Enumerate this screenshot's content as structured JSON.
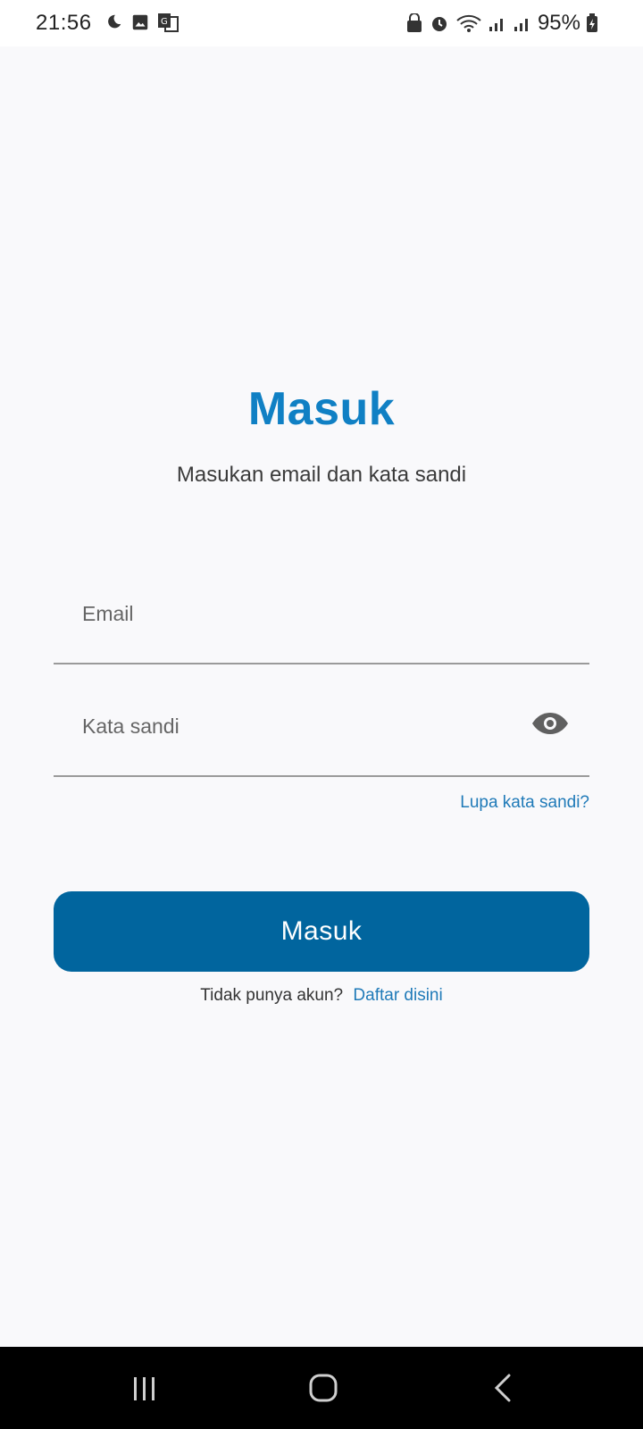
{
  "status_bar": {
    "time": "21:56",
    "battery_percent": "95%",
    "left_icons": [
      "moon-icon",
      "image-icon",
      "translate-icon"
    ],
    "right_icons": [
      "lock-icon",
      "alarm-icon",
      "wifi-icon",
      "signal-icon",
      "signal-icon",
      "battery-charging-icon"
    ]
  },
  "login": {
    "title": "Masuk",
    "subtitle": "Masukan email dan kata sandi",
    "email_placeholder": "Email",
    "password_placeholder": "Kata sandi",
    "forgot_password": "Lupa kata sandi?",
    "submit_label": "Masuk",
    "no_account_text": "Tidak punya akun?",
    "register_link": "Daftar disini"
  },
  "colors": {
    "title": "#1080c4",
    "button": "#01659e",
    "link": "#1f7ab8",
    "background": "#f9f9fb"
  },
  "nav_bar": {
    "buttons": [
      "recents-icon",
      "home-icon",
      "back-icon"
    ]
  }
}
